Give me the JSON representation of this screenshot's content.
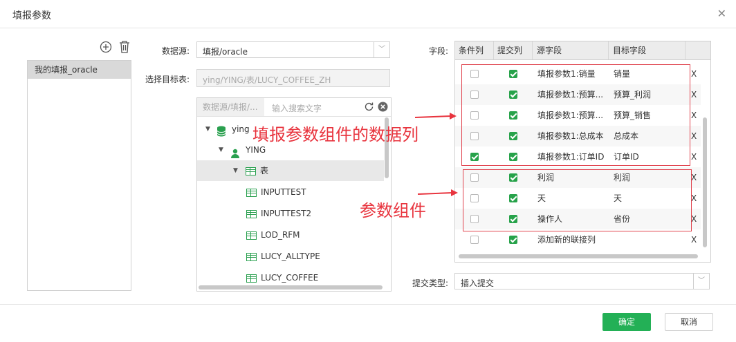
{
  "dialog": {
    "title": "填报参数",
    "close_glyph": "✕"
  },
  "left": {
    "items": [
      "我的填报_oracle"
    ]
  },
  "form": {
    "datasource_label": "数据源:",
    "datasource_value": "填报/oracle",
    "target_label": "选择目标表:",
    "target_value": "ying/YING/表/LUCY_COFFEE_ZH",
    "fields_label": "字段:",
    "submit_type_label": "提交类型:",
    "submit_type_value": "插入提交"
  },
  "tree": {
    "breadcrumb": "数据源/填报/...",
    "search_placeholder": "输入搜索文字",
    "nodes": [
      {
        "label": "ying",
        "type": "database"
      },
      {
        "label": "YING",
        "type": "user"
      },
      {
        "label": "表",
        "type": "folder"
      },
      {
        "label": "INPUTTEST",
        "type": "table"
      },
      {
        "label": "INPUTTEST2",
        "type": "table"
      },
      {
        "label": "LOD_RFM",
        "type": "table"
      },
      {
        "label": "LUCY_ALLTYPE",
        "type": "table"
      },
      {
        "label": "LUCY_COFFEE",
        "type": "table"
      }
    ]
  },
  "grid": {
    "headers": [
      "条件列",
      "提交列",
      "源字段",
      "目标字段"
    ],
    "delete_glyph": "X",
    "rows": [
      {
        "condition": false,
        "submit": true,
        "source": "填报参数1:销量",
        "target": "销量"
      },
      {
        "condition": false,
        "submit": true,
        "source": "填报参数1:预算...",
        "target": "预算_利润"
      },
      {
        "condition": false,
        "submit": true,
        "source": "填报参数1:预算...",
        "target": "预算_销售"
      },
      {
        "condition": false,
        "submit": true,
        "source": "填报参数1:总成本",
        "target": "总成本"
      },
      {
        "condition": true,
        "submit": true,
        "source": "填报参数1:订单ID",
        "target": "订单ID"
      },
      {
        "condition": false,
        "submit": true,
        "source": "利润",
        "target": "利润"
      },
      {
        "condition": false,
        "submit": true,
        "source": "天",
        "target": "天"
      },
      {
        "condition": false,
        "submit": true,
        "source": "操作人",
        "target": "省份"
      },
      {
        "condition": false,
        "submit": true,
        "source": "添加新的联接列",
        "target": ""
      }
    ]
  },
  "annotations": {
    "data_columns": "填报参数组件的数据列",
    "param_component": "参数组件",
    "color": "#e8343e"
  },
  "buttons": {
    "ok": "确定",
    "cancel": "取消"
  },
  "colors": {
    "accent": "#23b056",
    "annotation": "#e0414c"
  }
}
